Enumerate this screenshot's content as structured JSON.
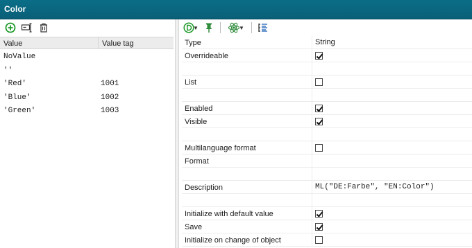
{
  "window": {
    "title": "Color"
  },
  "left_toolbar": {
    "icons": [
      "add-circle-icon",
      "edit-rename-icon",
      "delete-trash-icon"
    ]
  },
  "values_table": {
    "columns": [
      "Value",
      "Value tag"
    ],
    "rows": [
      {
        "value": "NoValue",
        "tag": ""
      },
      {
        "value": "''",
        "tag": ""
      },
      {
        "value": "'Red'",
        "tag": "1001"
      },
      {
        "value": "'Blue'",
        "tag": "1002"
      },
      {
        "value": "'Green'",
        "tag": "1003"
      }
    ]
  },
  "right_toolbar": {
    "icons": [
      "d-circle-dropdown-icon",
      "pin-icon",
      "atom-dropdown-icon",
      "list-tree-icon"
    ]
  },
  "properties": [
    {
      "name": "Type",
      "value": "String",
      "kind": "text"
    },
    {
      "name": "Overrideable",
      "kind": "check",
      "checked": true
    },
    {
      "name": "",
      "kind": "empty"
    },
    {
      "name": "List",
      "kind": "check",
      "checked": false
    },
    {
      "name": "",
      "kind": "empty"
    },
    {
      "name": "Enabled",
      "kind": "check",
      "checked": true
    },
    {
      "name": "Visible",
      "kind": "check",
      "checked": true
    },
    {
      "name": "",
      "kind": "empty"
    },
    {
      "name": "Multilanguage format",
      "kind": "check",
      "checked": false
    },
    {
      "name": "Format",
      "kind": "empty"
    },
    {
      "name": "",
      "kind": "empty"
    },
    {
      "name": "Description",
      "value": "ML(\"DE:Farbe\", \"EN:Color\")",
      "kind": "mono"
    },
    {
      "name": "",
      "kind": "empty"
    },
    {
      "name": "Initialize with default value",
      "kind": "check",
      "checked": true
    },
    {
      "name": "Save",
      "kind": "check",
      "checked": true
    },
    {
      "name": "Initialize on change of object",
      "kind": "check",
      "checked": false
    }
  ],
  "colors": {
    "titlebar": "#0b6e88",
    "add_green": "#1f9a2b",
    "pin_green": "#2e8b3a"
  }
}
